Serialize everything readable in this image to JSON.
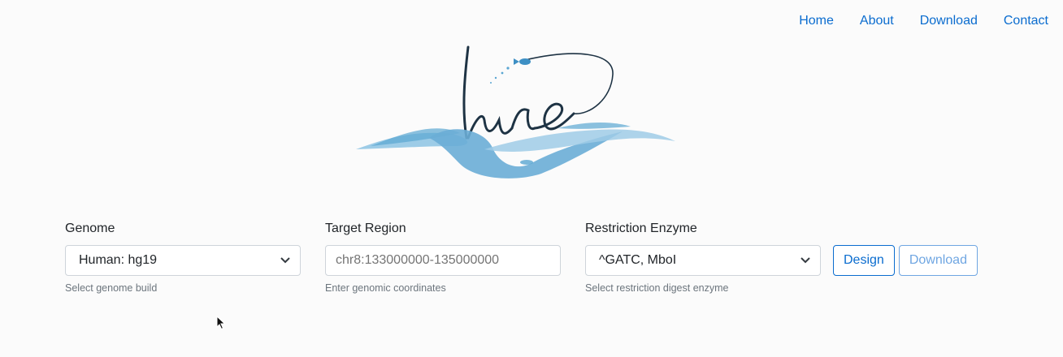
{
  "nav": {
    "items": [
      {
        "label": "Home"
      },
      {
        "label": "About"
      },
      {
        "label": "Download"
      },
      {
        "label": "Contact"
      }
    ]
  },
  "logo": {
    "text": "Lure",
    "icon": "lure-logo-icon"
  },
  "form": {
    "genome": {
      "label": "Genome",
      "selected": "Human: hg19",
      "help": "Select genome build"
    },
    "target_region": {
      "label": "Target Region",
      "placeholder": "chr8:133000000-135000000",
      "value": "",
      "help": "Enter genomic coordinates"
    },
    "enzyme": {
      "label": "Restriction Enzyme",
      "selected": "^GATC, MboI",
      "help": "Select restriction digest enzyme"
    },
    "buttons": {
      "design": "Design",
      "download": "Download"
    }
  },
  "colors": {
    "link": "#0a6ccf",
    "download_disabled": "#6fa6e2",
    "logo_ink": "#1e3344",
    "logo_wave": "#5aa6d2"
  }
}
